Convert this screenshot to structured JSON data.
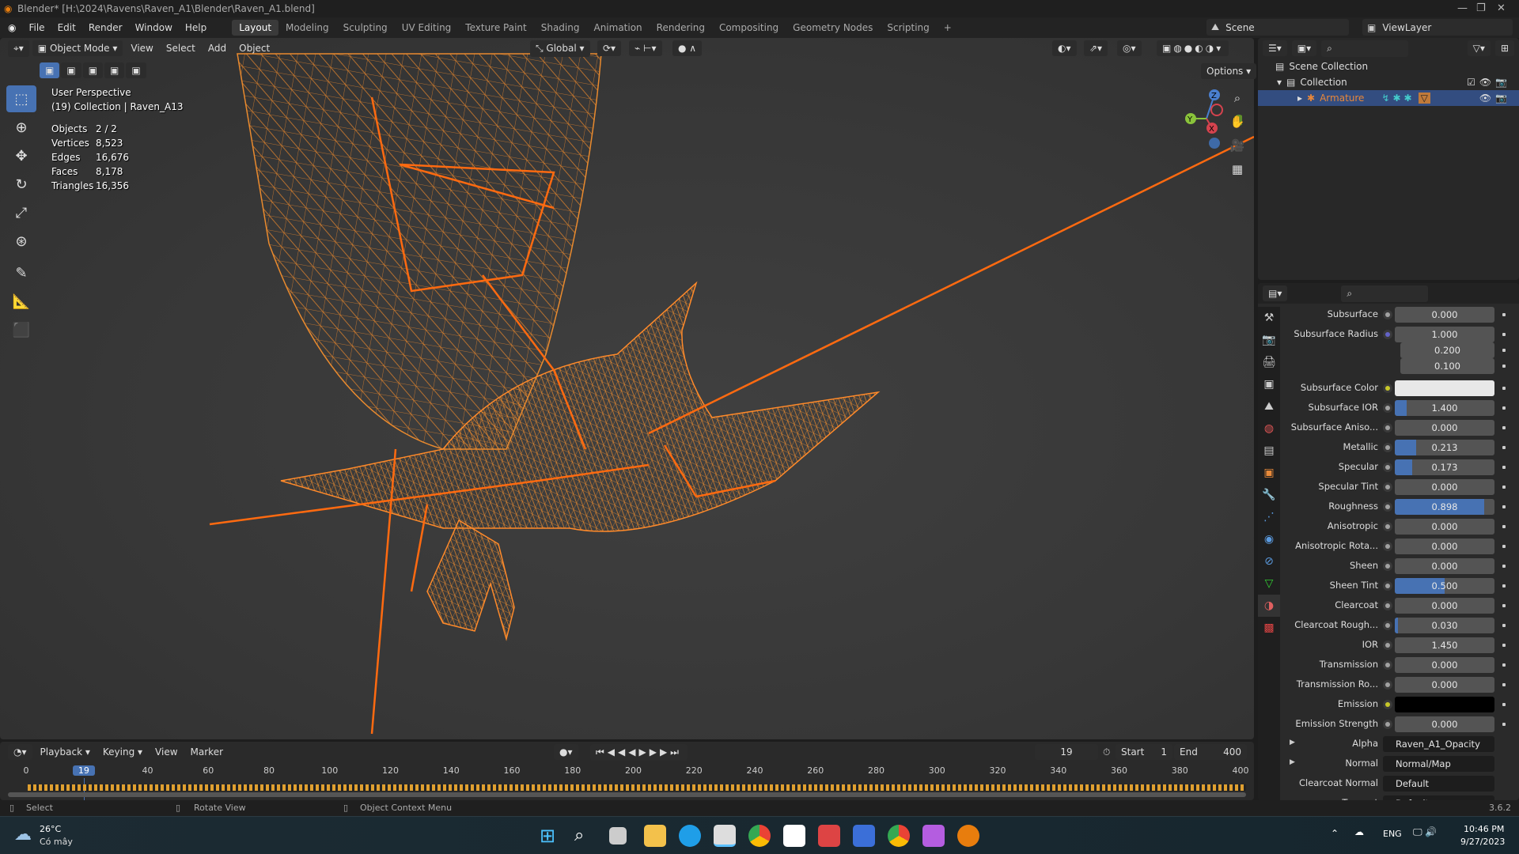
{
  "title": "Blender* [H:\\2024\\Ravens\\Raven_A1\\Blender\\Raven_A1.blend]",
  "menu": [
    "File",
    "Edit",
    "Render",
    "Window",
    "Help"
  ],
  "workspaces": [
    "Layout",
    "Modeling",
    "Sculpting",
    "UV Editing",
    "Texture Paint",
    "Shading",
    "Animation",
    "Rendering",
    "Compositing",
    "Geometry Nodes",
    "Scripting",
    "+"
  ],
  "scene": {
    "label": "Scene",
    "view_layer": "ViewLayer"
  },
  "viewport_header": {
    "mode": "Object Mode",
    "view": "View",
    "select": "Select",
    "add": "Add",
    "object": "Object",
    "orientation": "Global",
    "options": "Options"
  },
  "overlay": {
    "perspective": "User Perspective",
    "collection": "(19) Collection | Raven_A13",
    "stats": [
      {
        "k": "Objects",
        "v": "2 / 2"
      },
      {
        "k": "Vertices",
        "v": "8,523"
      },
      {
        "k": "Edges",
        "v": "16,676"
      },
      {
        "k": "Faces",
        "v": "8,178"
      },
      {
        "k": "Triangles",
        "v": "16,356"
      }
    ]
  },
  "gizmo": {
    "z": "Z",
    "y": "Y",
    "x": "X"
  },
  "outliner": {
    "scene_collection": "Scene Collection",
    "collection": "Collection",
    "armature": "Armature"
  },
  "properties": [
    {
      "label": "Subsurface",
      "value": "0.000",
      "fill": 0,
      "sock": "#a1a1a1"
    },
    {
      "label": "Subsurface Radius",
      "value": "1.000",
      "fill": 0,
      "sock": "#6363c7",
      "extra": [
        "0.200",
        "0.100"
      ]
    },
    {
      "label": "Subsurface Color",
      "value": "",
      "color": "#e8e8e8",
      "sock": "#c7c729"
    },
    {
      "label": "Subsurface IOR",
      "value": "1.400",
      "fill": 0.12,
      "sock": "#a1a1a1"
    },
    {
      "label": "Subsurface Aniso...",
      "value": "0.000",
      "fill": 0,
      "sock": "#a1a1a1"
    },
    {
      "label": "Metallic",
      "value": "0.213",
      "fill": 0.213,
      "sock": "#a1a1a1"
    },
    {
      "label": "Specular",
      "value": "0.173",
      "fill": 0.173,
      "sock": "#a1a1a1"
    },
    {
      "label": "Specular Tint",
      "value": "0.000",
      "fill": 0,
      "sock": "#a1a1a1"
    },
    {
      "label": "Roughness",
      "value": "0.898",
      "fill": 0.898,
      "sock": "#a1a1a1"
    },
    {
      "label": "Anisotropic",
      "value": "0.000",
      "fill": 0,
      "sock": "#a1a1a1"
    },
    {
      "label": "Anisotropic Rota...",
      "value": "0.000",
      "fill": 0,
      "sock": "#a1a1a1"
    },
    {
      "label": "Sheen",
      "value": "0.000",
      "fill": 0,
      "sock": "#a1a1a1"
    },
    {
      "label": "Sheen Tint",
      "value": "0.500",
      "fill": 0.5,
      "sock": "#a1a1a1"
    },
    {
      "label": "Clearcoat",
      "value": "0.000",
      "fill": 0,
      "sock": "#a1a1a1"
    },
    {
      "label": "Clearcoat Rough...",
      "value": "0.030",
      "fill": 0.03,
      "sock": "#a1a1a1"
    },
    {
      "label": "IOR",
      "value": "1.450",
      "fill": 0,
      "sock": "#a1a1a1"
    },
    {
      "label": "Transmission",
      "value": "0.000",
      "fill": 0,
      "sock": "#a1a1a1"
    },
    {
      "label": "Transmission Ro...",
      "value": "0.000",
      "fill": 0,
      "sock": "#a1a1a1"
    },
    {
      "label": "Emission",
      "value": "",
      "color": "#000000",
      "sock": "#c7c729"
    },
    {
      "label": "Emission Strength",
      "value": "0.000",
      "fill": 0,
      "sock": "#a1a1a1"
    },
    {
      "label": "Alpha",
      "value": "Raven_A1_Opacity",
      "link": true,
      "expand": true,
      "sock": "#a1a1a1"
    },
    {
      "label": "Normal",
      "value": "Normal/Map",
      "link": true,
      "expand": true,
      "sock": "#6363c7"
    },
    {
      "label": "Clearcoat Normal",
      "value": "Default",
      "link": true,
      "sock": "#6363c7"
    },
    {
      "label": "Tangent",
      "value": "Default",
      "link": true,
      "sock": "#6363c7"
    }
  ],
  "timeline": {
    "playback": "Playback",
    "keying": "Keying",
    "view": "View",
    "marker": "Marker",
    "current_frame": "19",
    "start_label": "Start",
    "start": "1",
    "end_label": "End",
    "end": "400",
    "ticks": [
      "0",
      "19",
      "40",
      "60",
      "80",
      "100",
      "120",
      "140",
      "160",
      "180",
      "200",
      "220",
      "240",
      "260",
      "280",
      "300",
      "320",
      "340",
      "360",
      "380",
      "400"
    ],
    "frame_min": 0,
    "frame_max": 400
  },
  "status": {
    "select": "Select",
    "rotate": "Rotate View",
    "context": "Object Context Menu",
    "version": "3.6.2"
  },
  "taskbar": {
    "temp": "26°C",
    "weather": "Có mây",
    "lang": "ENG",
    "time": "10:46 PM",
    "date": "9/27/2023"
  },
  "colors": {
    "accent": "#4772b3",
    "wire": "#ff7a1a",
    "active_object": "#e8873a"
  }
}
